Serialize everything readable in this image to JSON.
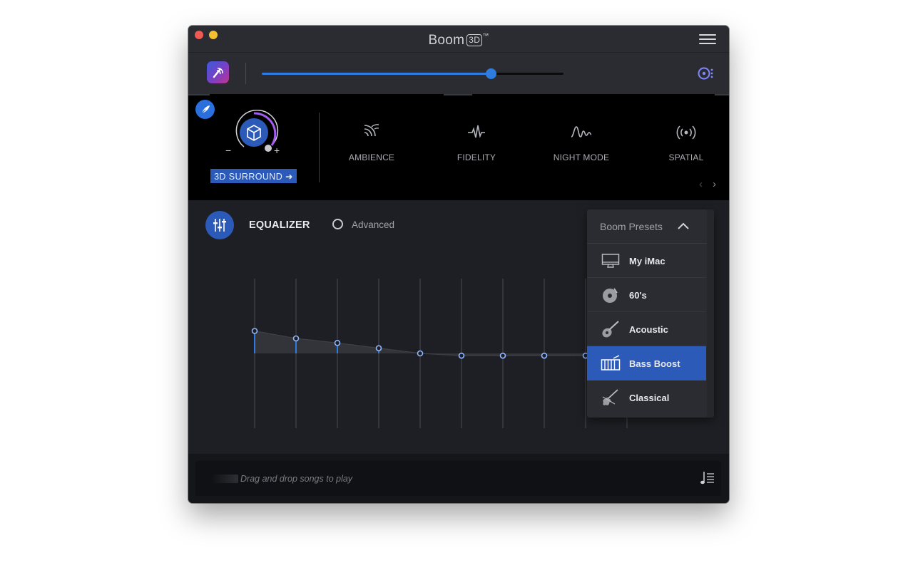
{
  "window": {
    "title": "Boom",
    "title_badge": "3D",
    "title_trademark": "™"
  },
  "volume": {
    "level": 0.76
  },
  "effects": {
    "surround_button": "3D SURROUND ➜",
    "items": [
      {
        "label": "AMBIENCE",
        "icon": "ambience-icon"
      },
      {
        "label": "FIDELITY",
        "icon": "fidelity-icon"
      },
      {
        "label": "NIGHT MODE",
        "icon": "night-mode-icon"
      },
      {
        "label": "SPATIAL",
        "icon": "spatial-icon"
      }
    ],
    "dial_minus": "−",
    "dial_plus": "+"
  },
  "equalizer": {
    "title": "EQUALIZER",
    "advanced_label": "Advanced",
    "band_values": [
      0.3,
      0.2,
      0.14,
      0.07,
      0.0,
      -0.03,
      -0.03,
      -0.03,
      -0.03,
      0.0
    ]
  },
  "presets": {
    "title": "Boom Presets",
    "items": [
      {
        "label": "My iMac",
        "icon": "imac-icon",
        "active": false
      },
      {
        "label": "60's",
        "icon": "vinyl-record-icon",
        "active": false
      },
      {
        "label": "Acoustic",
        "icon": "guitar-icon",
        "active": false
      },
      {
        "label": "Bass Boost",
        "icon": "drum-icon",
        "active": true
      },
      {
        "label": "Classical",
        "icon": "violin-icon",
        "active": false
      }
    ]
  },
  "player": {
    "drop_text": "Drag and drop songs to play"
  },
  "colors": {
    "accent": "#2f7ce0",
    "active_preset": "#2c5ab8",
    "close": "#ee5a52",
    "minimize": "#f5bf2f"
  }
}
